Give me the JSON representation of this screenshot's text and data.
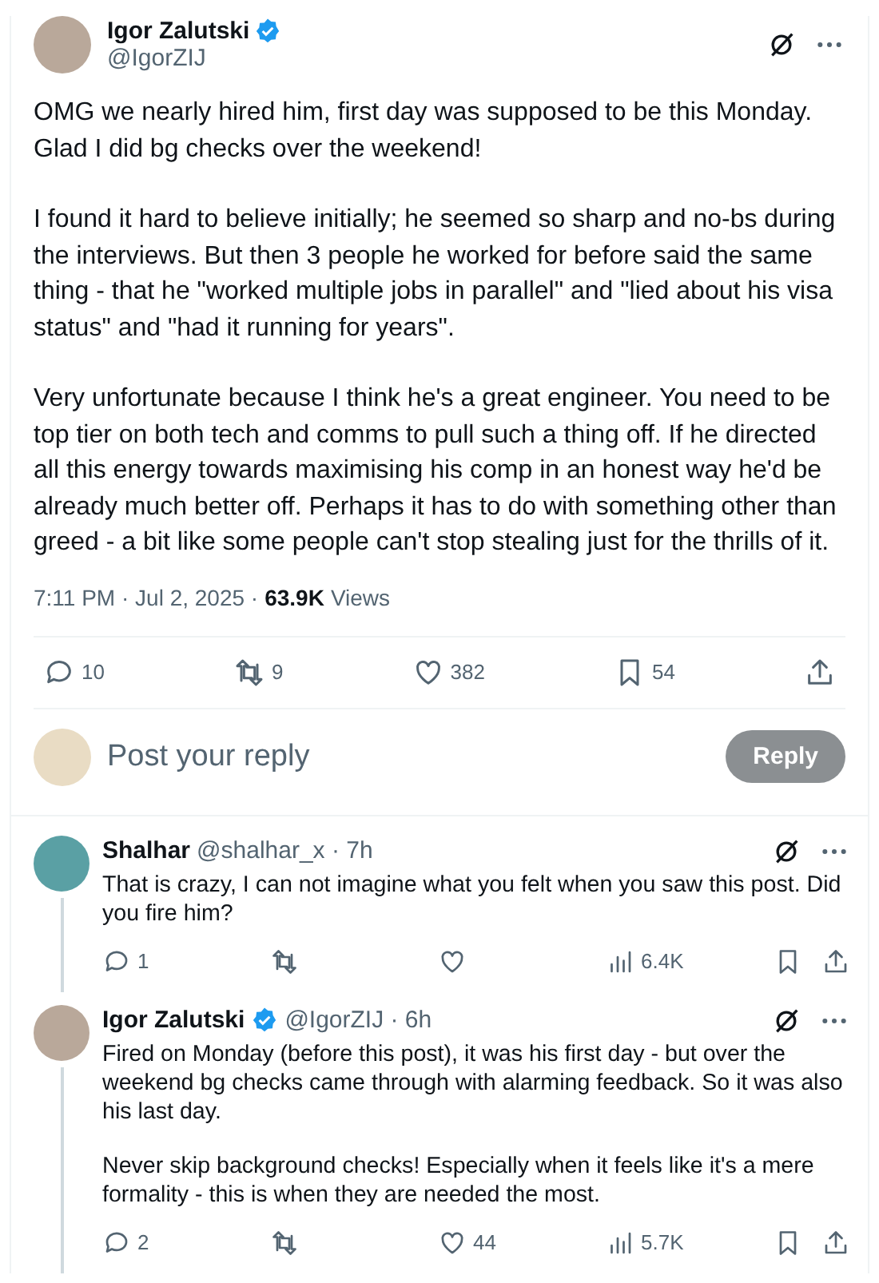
{
  "main_post": {
    "author": {
      "name": "Igor Zalutski",
      "verified": true,
      "handle": "@IgorZIJ"
    },
    "paragraphs": [
      "OMG we nearly hired him, first day was supposed to be this Monday. Glad I did bg checks over the weekend!",
      "I found it hard to believe initially; he seemed so sharp and no-bs during the interviews. But then 3 people he worked for before said the same thing - that he \"worked multiple jobs in parallel\" and \"lied about his visa status\" and \"had it running for years\".",
      "Very unfortunate because I think he's a great engineer. You need to be top tier on both tech and comms to pull such a thing off. If he directed all this energy towards maximising his comp in an honest way he'd be already much better off. Perhaps it has to do with something other than greed - a bit like some people can't stop stealing just for the thrills of it."
    ],
    "timestamp": "7:11 PM · Jul 2, 2025 ·",
    "views_count": "63.9K",
    "views_label": "Views",
    "actions": [
      {
        "kind": "reply",
        "count": "10"
      },
      {
        "kind": "repost",
        "count": "9"
      },
      {
        "kind": "like",
        "count": "382"
      },
      {
        "kind": "bookmark",
        "count": "54"
      },
      {
        "kind": "share"
      }
    ]
  },
  "reply_box": {
    "placeholder": "Post your reply",
    "button": "Reply",
    "disabled": true
  },
  "replies": [
    {
      "name": "Shalhar",
      "verified": false,
      "handle_time": "@shalhar_x · 7h",
      "paragraphs": [
        "That is crazy, I can not imagine what you felt when you saw this post. Did you fire him?"
      ],
      "actions": [
        {
          "kind": "reply",
          "count": "1"
        },
        {
          "kind": "repost"
        },
        {
          "kind": "like"
        },
        {
          "kind": "views",
          "count": "6.4K"
        },
        {
          "kind": "bookmark"
        },
        {
          "kind": "share"
        }
      ]
    },
    {
      "name": "Igor Zalutski",
      "verified": true,
      "handle_time": "@IgorZIJ · 6h",
      "paragraphs": [
        "Fired on Monday (before this post), it was his first day - but over the weekend bg checks came through with alarming feedback. So it was also his last day.",
        "Never skip background checks! Especially when it feels like it's a mere formality - this is when they are needed the most."
      ],
      "actions": [
        {
          "kind": "reply",
          "count": "2"
        },
        {
          "kind": "repost"
        },
        {
          "kind": "like",
          "count": "44"
        },
        {
          "kind": "views",
          "count": "5.7K"
        },
        {
          "kind": "bookmark"
        },
        {
          "kind": "share"
        }
      ]
    }
  ]
}
